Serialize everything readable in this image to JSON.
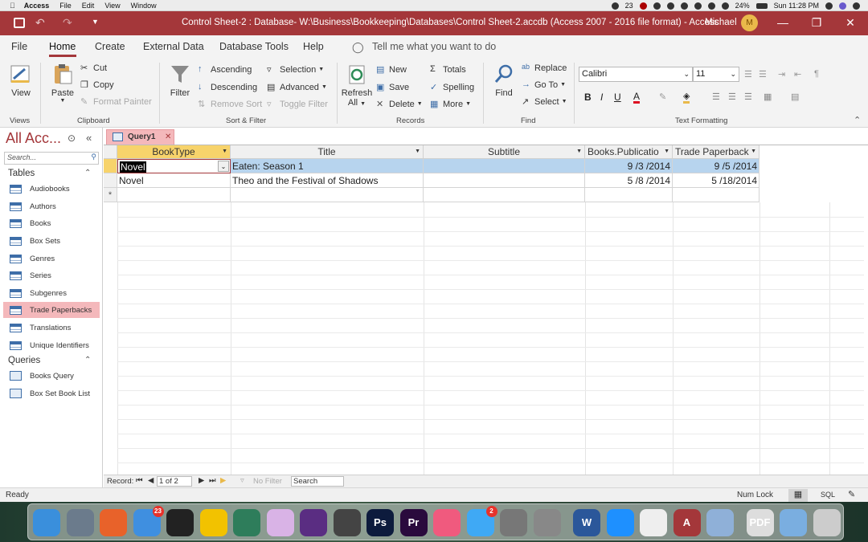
{
  "mac_menu": {
    "app": "Access",
    "items": [
      "File",
      "Edit",
      "View",
      "Window"
    ],
    "status": {
      "notifications": "23",
      "battery": "24%",
      "clock": "Sun 11:28 PM"
    }
  },
  "window": {
    "title": "Control Sheet-2 : Database- W:\\Business\\Bookkeeping\\Databases\\Control Sheet-2.accdb (Access 2007 - 2016 file format)  -  Access",
    "user": "Michael",
    "avatar_initial": "M",
    "brand_color": "#a4373a"
  },
  "ribbon_tabs": [
    "File",
    "Home",
    "Create",
    "External Data",
    "Database Tools",
    "Help"
  ],
  "tell_me": "Tell me what you want to do",
  "ribbon": {
    "views": {
      "view": "View",
      "group": "Views"
    },
    "clipboard": {
      "paste": "Paste",
      "cut": "Cut",
      "copy": "Copy",
      "format_painter": "Format Painter",
      "group": "Clipboard"
    },
    "sort_filter": {
      "filter": "Filter",
      "ascending": "Ascending",
      "descending": "Descending",
      "remove_sort": "Remove Sort",
      "selection": "Selection",
      "advanced": "Advanced",
      "toggle_filter": "Toggle Filter",
      "group": "Sort & Filter"
    },
    "records": {
      "refresh": "Refresh",
      "refresh_all": "All",
      "new": "New",
      "save": "Save",
      "delete": "Delete",
      "totals": "Totals",
      "spelling": "Spelling",
      "more": "More",
      "group": "Records"
    },
    "find": {
      "find": "Find",
      "replace": "Replace",
      "goto": "Go To",
      "select": "Select",
      "group": "Find"
    },
    "text_formatting": {
      "font": "Calibri",
      "size": "11",
      "bold": "B",
      "italic": "I",
      "underline": "U",
      "group": "Text Formatting"
    }
  },
  "nav": {
    "title": "All Acc...",
    "search_placeholder": "Search...",
    "tables_label": "Tables",
    "tables": [
      "Audiobooks",
      "Authors",
      "Books",
      "Box Sets",
      "Genres",
      "Series",
      "Subgenres",
      "Trade Paperbacks",
      "Translations",
      "Unique Identifiers"
    ],
    "selected": "Trade Paperbacks",
    "queries_label": "Queries",
    "queries": [
      "Books Query",
      "Box Set Book List"
    ]
  },
  "document_tab": "Query1",
  "datasheet": {
    "columns": [
      "BookType",
      "Title",
      "Subtitle",
      "Books.Publicatio",
      "Trade Paperback"
    ],
    "rows": [
      [
        "Novel",
        "Eaten: Season 1",
        "",
        "9 /3 /2014",
        "9 /5 /2014"
      ],
      [
        "Novel",
        "Theo and the Festival of Shadows",
        "",
        "5 /8 /2014",
        "5 /18/2014"
      ]
    ],
    "new_row_marker": "*"
  },
  "record_bar": {
    "label": "Record:",
    "position": "1 of 2",
    "filter": "No Filter",
    "search": "Search"
  },
  "status_bar": {
    "ready": "Ready",
    "num_lock": "Num Lock",
    "sql": "SQL"
  },
  "dock": {
    "apps": [
      "finder-icon",
      "launchpad-icon",
      "firefox-icon",
      "mail-icon",
      "scrivener-icon",
      "tes-icon",
      "stack-icon",
      "flower-icon",
      "audio-icon",
      "final-cut-icon",
      "photoshop-icon",
      "premiere-icon",
      "music-icon",
      "messages-icon",
      "settings-icon",
      "automator-icon",
      "word-icon",
      "windows-icon",
      "notes-icon",
      "access-icon",
      "preview-icon",
      "pdf-icon",
      "folder-icon",
      "trash-icon"
    ],
    "mail_badge": "23",
    "messages_badge": "2"
  }
}
